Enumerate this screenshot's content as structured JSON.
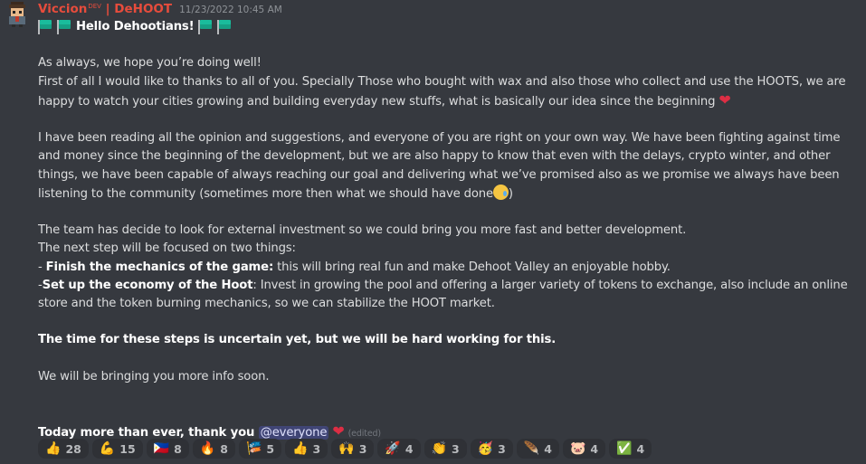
{
  "message": {
    "author": "Viccion",
    "author_tag": "DEV",
    "author_suffix": " | DeHOOT",
    "timestamp": "11/23/2022 10:45 AM",
    "greeting": "Hello Dehootians!",
    "p1_line1": "As always, we hope you’re doing well!",
    "p1_line2": "First of all I would like to thanks to all of you. Specially Those who bought with wax and also those who collect and use the HOOTS, we are happy to watch your cities growing and building everyday new stuffs, what is basically our idea since the beginning",
    "p2": "I have been reading all the opinion and suggestions, and everyone of you are right on your own way. We have been fighting against time and money since the beginning of the development, but we are also happy to know that even with the delays, crypto winter, and other things, we have been capable of always reaching our goal and delivering what we’ve promised also as we promise we always have been listening to the community (sometimes more then what we should have done",
    "p2_end": ")",
    "p3_line1": "The team has decide to look for external investment so we could bring you more fast and better development.",
    "p3_line2": "The next step will be focused on two things:",
    "item1_prefix": "- ",
    "item1_bold": "Finish the mechanics of the game:",
    "item1_text": " this will bring real fun and make Dehoot Valley an enjoyable hobby.",
    "item2_prefix": "-",
    "item2_bold": "Set up the economy of the Hoot",
    "item2_text": ": Invest in growing the pool and offering a larger variety of tokens to exchange, also include an online store and the token burning mechanics, so we can stabilize the HOOT market.",
    "p4": "The time for these steps is uncertain yet, but we will be hard working for this.",
    "p5": "We will be bringing you more info soon.",
    "closing": "Today more than ever, thank you ",
    "mention": "@everyone",
    "edited": "(edited)"
  },
  "reactions": [
    {
      "emoji": "👍",
      "count": "28",
      "icon": "thumbs-up-icon"
    },
    {
      "emoji": "💪",
      "count": "15",
      "icon": "flexed-biceps-icon"
    },
    {
      "emoji": "🇵🇭",
      "count": "8",
      "icon": "philippines-flag-icon"
    },
    {
      "emoji": "🔥",
      "count": "8",
      "icon": "fire-icon"
    },
    {
      "emoji": "🎏",
      "count": "5",
      "icon": "custom-flag-icon"
    },
    {
      "emoji": "👍",
      "count": "3",
      "icon": "thumbs-up-icon"
    },
    {
      "emoji": "🙌",
      "count": "3",
      "icon": "raising-hands-icon"
    },
    {
      "emoji": "🚀",
      "count": "4",
      "icon": "rocket-icon"
    },
    {
      "emoji": "👏",
      "count": "3",
      "icon": "clapping-hands-icon"
    },
    {
      "emoji": "🥳",
      "count": "3",
      "icon": "partying-face-icon"
    },
    {
      "emoji": "🪶",
      "count": "4",
      "icon": "feather-icon"
    },
    {
      "emoji": "🐷",
      "count": "4",
      "icon": "pig-icon"
    },
    {
      "emoji": "✅",
      "count": "4",
      "icon": "check-mark-icon"
    }
  ],
  "colors": {
    "background": "#36393f",
    "author": "#e74c3c",
    "text": "#dcddde",
    "mention_bg": "#4f5570",
    "reaction_bg": "#2f3136"
  }
}
